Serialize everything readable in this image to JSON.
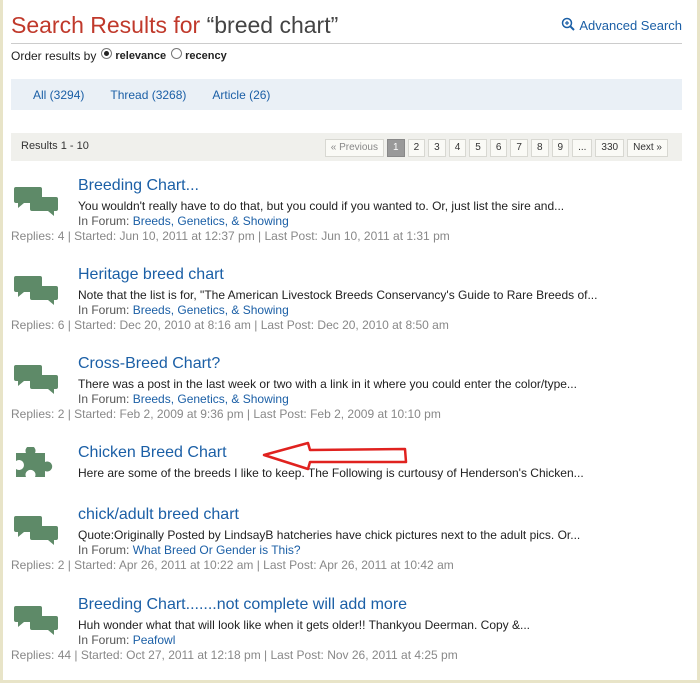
{
  "header": {
    "title_prefix": "Search Results for ",
    "query": "“breed chart”",
    "advanced_label": "Advanced Search"
  },
  "order": {
    "label": "Order results by",
    "options": [
      {
        "label": "relevance",
        "selected": true
      },
      {
        "label": "recency",
        "selected": false
      }
    ]
  },
  "tabs": [
    {
      "label": "All (3294)"
    },
    {
      "label": "Thread (3268)"
    },
    {
      "label": "Article (26)"
    }
  ],
  "results_bar": {
    "count": "Results 1 - 10",
    "pager": [
      "« Previous",
      "1",
      "2",
      "3",
      "4",
      "5",
      "6",
      "7",
      "8",
      "9",
      "...",
      "330",
      "Next »"
    ],
    "current_page": "1"
  },
  "results": [
    {
      "icon": "thread-icon",
      "title": "Breeding Chart...",
      "snippet": "You wouldn't really have to do that, but you could if you wanted to. Or, just list the sire and...",
      "forum_label": "In Forum: ",
      "forum": "Breeds, Genetics, & Showing",
      "meta": "Replies: 4   |  Started: Jun 10, 2011 at 12:37 pm   |  Last Post: Jun 10, 2011 at 1:31 pm"
    },
    {
      "icon": "thread-icon",
      "title": "Heritage breed chart",
      "snippet": "Note that the list is for, \"The American Livestock Breeds Conservancy's Guide to Rare Breeds of...",
      "forum_label": "In Forum: ",
      "forum": "Breeds, Genetics, & Showing",
      "meta": "Replies: 6   |  Started: Dec 20, 2010 at 8:16 am   |  Last Post: Dec 20, 2010 at 8:50 am"
    },
    {
      "icon": "thread-icon",
      "title": "Cross-Breed Chart?",
      "snippet": "There was a post in the last week or two with a link in it where you could enter the color/type...",
      "forum_label": "In Forum: ",
      "forum": "Breeds, Genetics, & Showing",
      "meta": "Replies: 2   |  Started: Feb 2, 2009 at 9:36 pm   |  Last Post: Feb 2, 2009 at 10:10 pm"
    },
    {
      "icon": "article-icon",
      "title": "Chicken Breed Chart",
      "snippet": "Here are some of the breeds I like to keep.  The Following is curtousy of Henderson's Chicken...",
      "forum_label": "",
      "forum": "",
      "meta": ""
    },
    {
      "icon": "thread-icon",
      "title": "chick/adult breed chart",
      "snippet": "Quote:Originally Posted by LindsayB hatcheries have chick pictures next to the adult pics. Or...",
      "forum_label": "In Forum: ",
      "forum": "What Breed Or Gender is This?",
      "meta": "Replies: 2   |  Started: Apr 26, 2011 at 10:22 am   |  Last Post: Apr 26, 2011 at 10:42 am"
    },
    {
      "icon": "thread-icon",
      "title": "Breeding Chart.......not complete will add more",
      "snippet": "Huh wonder what that will look like when it gets older!!          Thankyou Deerman.    Copy &...",
      "forum_label": "In Forum: ",
      "forum": "Peafowl",
      "meta": "Replies: 44   |  Started: Oct 27, 2011 at 12:18 pm   |  Last Post: Nov 26, 2011 at 4:25 pm"
    }
  ],
  "colors": {
    "title_red": "#c0392b",
    "link_blue": "#1b5fa6",
    "icon_green": "#5e8a68",
    "arrow_red": "#e0221f"
  }
}
